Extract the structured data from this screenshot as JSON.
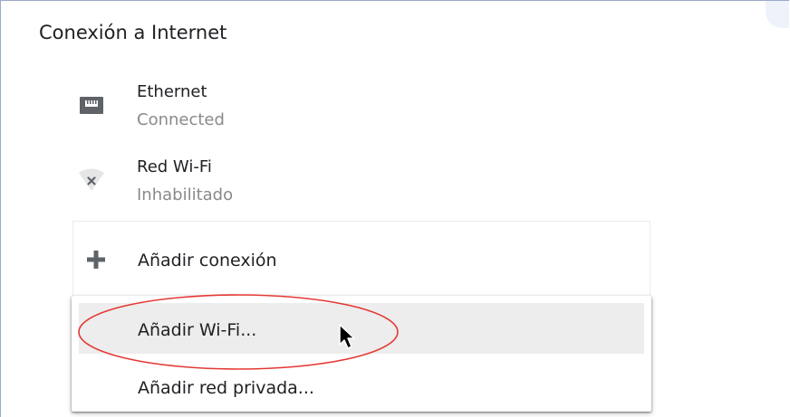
{
  "section": {
    "title": "Conexión a Internet"
  },
  "networks": [
    {
      "name": "Ethernet",
      "status": "Connected",
      "icon": "ethernet-icon"
    },
    {
      "name": "Red Wi-Fi",
      "status": "Inhabilitado",
      "icon": "wifi-off-icon"
    }
  ],
  "add_connection": {
    "label": "Añadir conexión",
    "icon": "plus-icon"
  },
  "menu": {
    "items": [
      {
        "label": "Añadir Wi-Fi...",
        "highlighted": true
      },
      {
        "label": "Añadir red privada...",
        "highlighted": false
      }
    ]
  },
  "colors": {
    "annotation": "#e53935",
    "highlight": "#ededed",
    "secondary_text": "#8a8a8a",
    "panel_border": "#9aa9c9"
  }
}
